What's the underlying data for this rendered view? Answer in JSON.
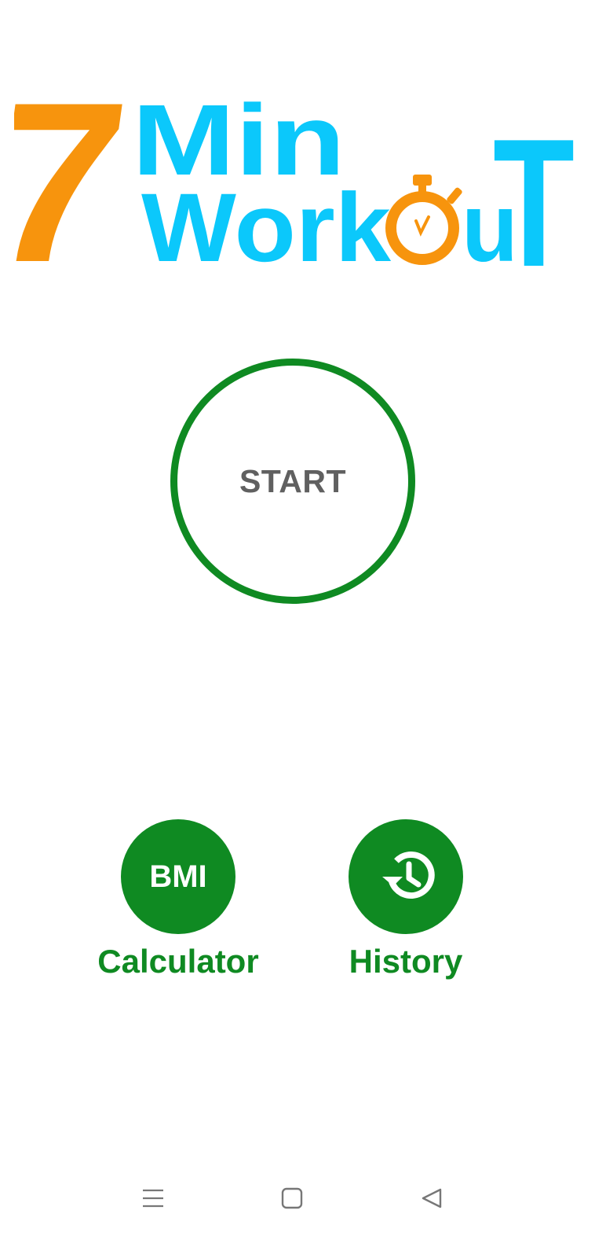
{
  "logo": {
    "number": "7",
    "line1": "Min",
    "line2_prefix": "Work",
    "line2_suffix_u": "u",
    "line2_suffix_t": "T",
    "colors": {
      "orange": "#f7940d",
      "cyan": "#0bc8fb"
    },
    "icon": "stopwatch-icon"
  },
  "start": {
    "label": "START",
    "ring_color": "#0f8a22",
    "text_color": "#606060"
  },
  "actions": {
    "bmi": {
      "circle_text": "BMI",
      "label": "Calculator"
    },
    "history": {
      "icon": "history-clock-icon",
      "label": "History"
    },
    "color": "#0f8a22"
  },
  "nav": {
    "menu_icon": "menu-icon",
    "home_icon": "home-square-icon",
    "back_icon": "back-triangle-icon"
  }
}
